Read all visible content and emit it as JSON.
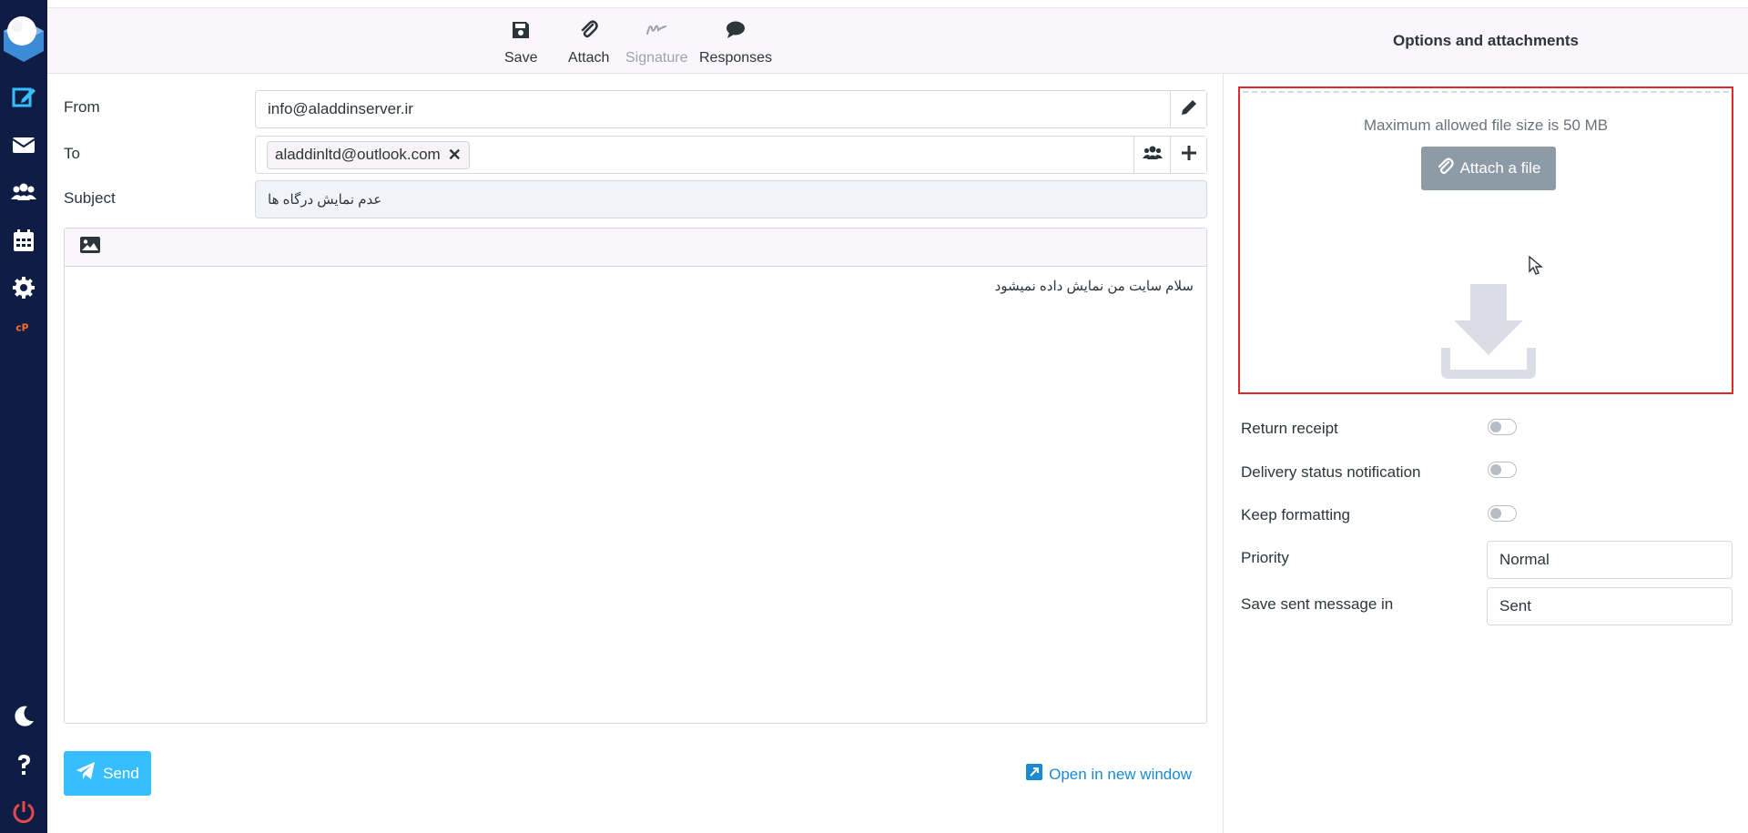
{
  "toolbar": {
    "save_label": "Save",
    "attach_label": "Attach",
    "signature_label": "Signature",
    "responses_label": "Responses"
  },
  "form": {
    "from_label": "From",
    "from_value": "info@aladdinserver.ir",
    "to_label": "To",
    "to_recipient": "aladdinltd@outlook.com",
    "remove_symbol": "✕",
    "subject_label": "Subject",
    "subject_value": "عدم نمایش درگاه ها"
  },
  "editor": {
    "body_text": "سلام سایت من نمایش داده نمیشود"
  },
  "footer": {
    "send_label": "Send",
    "open_new_label": "Open in new window"
  },
  "options": {
    "title": "Options and attachments",
    "max_size_text": "Maximum allowed file size is 50 MB",
    "attach_file_label": "Attach a file",
    "return_receipt_label": "Return receipt",
    "dsn_label": "Delivery status notification",
    "keep_formatting_label": "Keep formatting",
    "priority_label": "Priority",
    "priority_value": "Normal",
    "save_sent_label": "Save sent message in",
    "save_sent_value": "Sent",
    "return_receipt_on": false,
    "dsn_on": false,
    "keep_formatting_on": false
  },
  "nav": {
    "items": [
      "compose-icon",
      "mail-icon",
      "contacts-icon",
      "calendar-icon",
      "settings-icon",
      "cpanel-icon",
      "dark-mode-icon",
      "help-icon",
      "logout-icon"
    ]
  },
  "colors": {
    "nav_bg": "#0f1d45",
    "accent": "#37beff",
    "link": "#1a8ad1",
    "highlight_border": "#e02a2a",
    "logout": "#e5484d"
  }
}
